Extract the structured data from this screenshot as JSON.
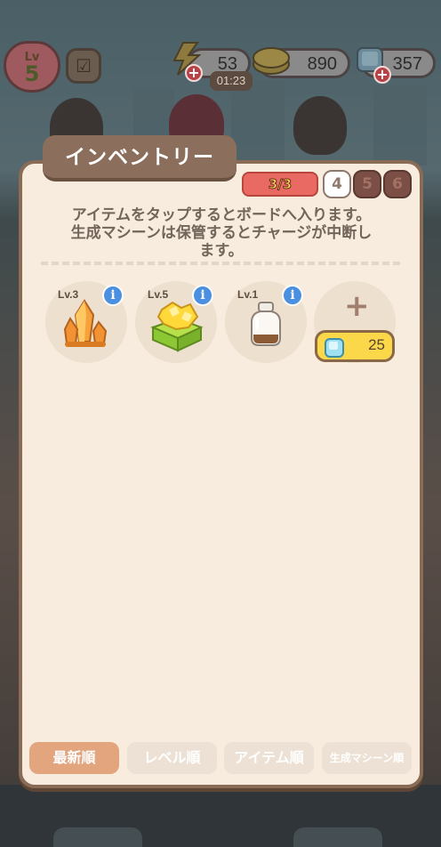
{
  "hud": {
    "level_label": "Lv",
    "level_value": "5",
    "energy_value": "53",
    "energy_timer": "01:23",
    "coins_value": "890",
    "gems_value": "357",
    "plus_symbol": "+"
  },
  "inventory": {
    "title": "インベントリー",
    "page_indicator": "3/3",
    "pages": [
      "4",
      "5",
      "6"
    ],
    "description_lines": [
      "アイテムをタップするとボードへ入ります。",
      "生成マシーンは保管するとチャージが中断し",
      "ます。"
    ],
    "items": [
      {
        "level": "Lv.3",
        "icon": "orange-crystal-icon"
      },
      {
        "level": "Lv.5",
        "icon": "gold-nugget-box-icon"
      },
      {
        "level": "Lv.1",
        "icon": "glass-jar-icon"
      }
    ],
    "info_symbol": "i",
    "add_slot_symbol": "+",
    "add_slot_cost": "25",
    "sort_buttons": [
      "最新順",
      "レベル順",
      "アイテム順",
      "生成マシーン順"
    ],
    "active_sort": "最新順"
  },
  "colors": {
    "panel_bg": "#f7ecde",
    "panel_border": "#8a6b55",
    "active_sort": "#e2a57e",
    "page_current": "#e86a62",
    "info_button": "#4a8fe0",
    "buy_button": "#fbd74a"
  }
}
